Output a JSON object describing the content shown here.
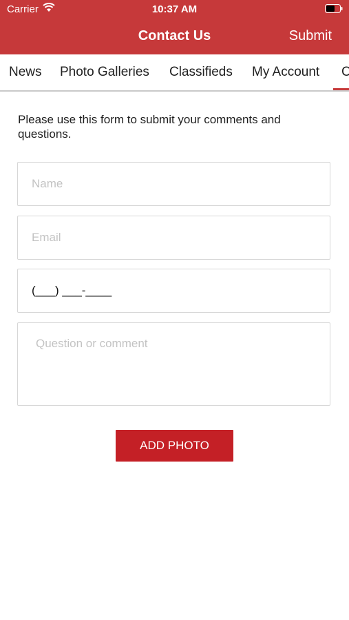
{
  "status_bar": {
    "carrier": "Carrier",
    "time": "10:37 AM",
    "wifi_icon": "wifi-icon",
    "battery_icon": "battery-icon"
  },
  "nav": {
    "title": "Contact Us",
    "submit_label": "Submit"
  },
  "tabs": [
    {
      "label": "News"
    },
    {
      "label": "Photo Galleries"
    },
    {
      "label": "Classifieds"
    },
    {
      "label": "My Account"
    },
    {
      "label": "C",
      "active": true
    }
  ],
  "form": {
    "intro": "Please use this form to submit your comments and questions.",
    "name_placeholder": "Name",
    "email_placeholder": "Email",
    "phone_value": "(___) ___-____",
    "comment_placeholder": "Question or comment",
    "add_photo_label": "ADD PHOTO"
  },
  "colors": {
    "header_bg": "#c6393a",
    "button_bg": "#c42026",
    "active_tab_indicator": "#c6393a"
  }
}
